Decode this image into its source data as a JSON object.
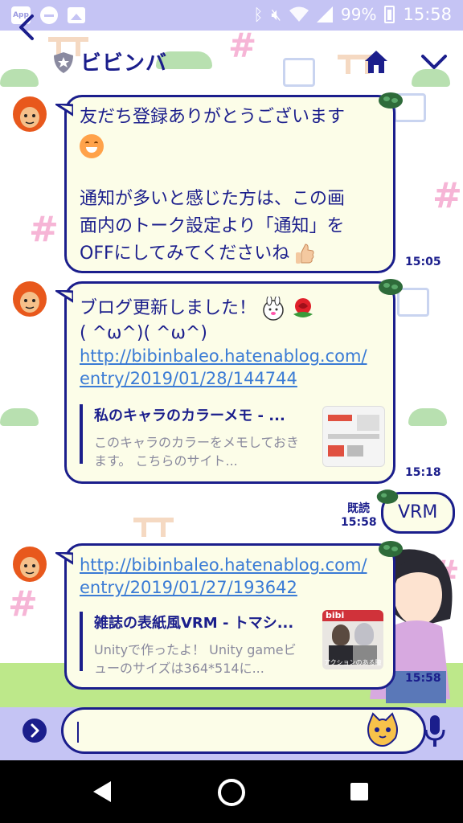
{
  "status_bar": {
    "app_label": "App",
    "battery": "99%",
    "time": "15:58"
  },
  "header": {
    "title": "ビビンバ"
  },
  "messages": [
    {
      "line1": "友だち登録ありがとうございます",
      "line2": "通知が多いと感じた方は、この画",
      "line3": "面内のトーク設定より「通知」を",
      "line4": "OFFにしてみてくださいね",
      "time": "15:05"
    },
    {
      "line1": "ブログ更新しました！",
      "line2": "( ^ω^)( ^ω^)",
      "link": "http://bibinbaleo.hatenablog.com/entry/2019/01/28/144744",
      "preview_title": "私のキャラのカラーメモ - ...",
      "preview_desc": "このキャラのカラーをメモしておきます。 こちらのサイト...",
      "time": "15:18"
    },
    {
      "text": "VRM",
      "read": "既読",
      "time": "15:58"
    },
    {
      "link": "http://bibinbaleo.hatenablog.com/entry/2019/01/27/193642",
      "preview_title": "雑誌の表紙風VRM - トマシ...",
      "preview_desc": "Unityで作ったよ！ Unity gameビューのサイズは364*514に...",
      "thumb_text": "アクションのある瞳",
      "time": "15:58"
    }
  ],
  "input": {
    "value": ""
  },
  "colors": {
    "accent": "#1b1e8c",
    "status_bar": "#c5c4f4",
    "bubble": "#fcfde8",
    "link": "#3a7bd5"
  }
}
